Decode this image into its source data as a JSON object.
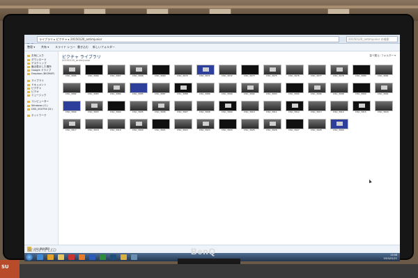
{
  "monitor": {
    "brand": "BenQ",
    "series": "SENSEYE LED"
  },
  "window": {
    "address_path": "ライブラリ ▸ ピクチャ ▸ 20150120_antimjunior",
    "search_placeholder": "20150120_antimjunior の検索",
    "toolbar": [
      "整理 ▾",
      "共有 ▾",
      "スライド ショー",
      "書き込む",
      "新しいフォルダー"
    ],
    "nav_items": [
      "お気に入り",
      "ダウンロード",
      "デスクトップ",
      "最近表示した場所",
      "Google ドライブ",
      "Dropbox (BIGMAP)",
      "ライブラリ",
      "ドキュメント",
      "ピクチャ",
      "ビデオ",
      "ミュージック",
      "コンピューター",
      "Windows (C:)",
      "DSS_000794 (D:)",
      "ネットワーク"
    ],
    "library_title": "ピクチャ ライブラリ",
    "library_subtitle": "20150120_antimjunior",
    "arrange": "並べ替え: フォルダー ▾",
    "status": "111 個の項目",
    "clock_time": "13:08",
    "clock_date": "2015/01/21"
  },
  "thumbnails": [
    [
      "DSC_3065",
      "DSC_3066",
      "DSC_3067",
      "DSC_3068",
      "DSC_3069",
      "DSC_3070",
      "DSC_3071",
      "DSC_3072",
      "DSC_3073",
      "DSC_3075",
      "DSC_3076",
      "DSC_3077",
      "DSC_3078",
      "DSC_3080",
      "DSC_3081"
    ],
    [
      "DSC_3082",
      "DSC_3083",
      "DSC_3084",
      "DSC_3085",
      "DSC_3087",
      "DSC_3088",
      "DSC_3089",
      "DSC_3090",
      "DSC_3092",
      "DSC_3093",
      "DSC_3094",
      "DSC_3096",
      "DSC_3098",
      "DSC_3900",
      "DSC_3901"
    ],
    [
      "DSC_3902",
      "DSC_3903",
      "DSC_3904",
      "DSC_3905",
      "DSC_3906",
      "DSC_3907",
      "DSC_3908",
      "DSC_3909",
      "DSC_3910",
      "DSC_3911",
      "DSC_3912",
      "DSC_3913",
      "DSC_3914",
      "DSC_3915",
      "DSC_3916"
    ],
    [
      "DSC_3917",
      "DSC_3918",
      "DSC_3919",
      "DSC_3920",
      "DSC_3921",
      "DSC_3922",
      "DSC_3923",
      "DSC_3924",
      "DSC_3925",
      "DSC_3926",
      "DSC_3927",
      "DSC_3928",
      "DSC_3929"
    ]
  ],
  "taskbar_icons": [
    "ie-icon",
    "chrome-icon",
    "explorer-icon",
    "media-icon",
    "firefox-icon",
    "word-icon",
    "excel-icon",
    "photoshop-icon",
    "folder-icon",
    "app-icon"
  ]
}
